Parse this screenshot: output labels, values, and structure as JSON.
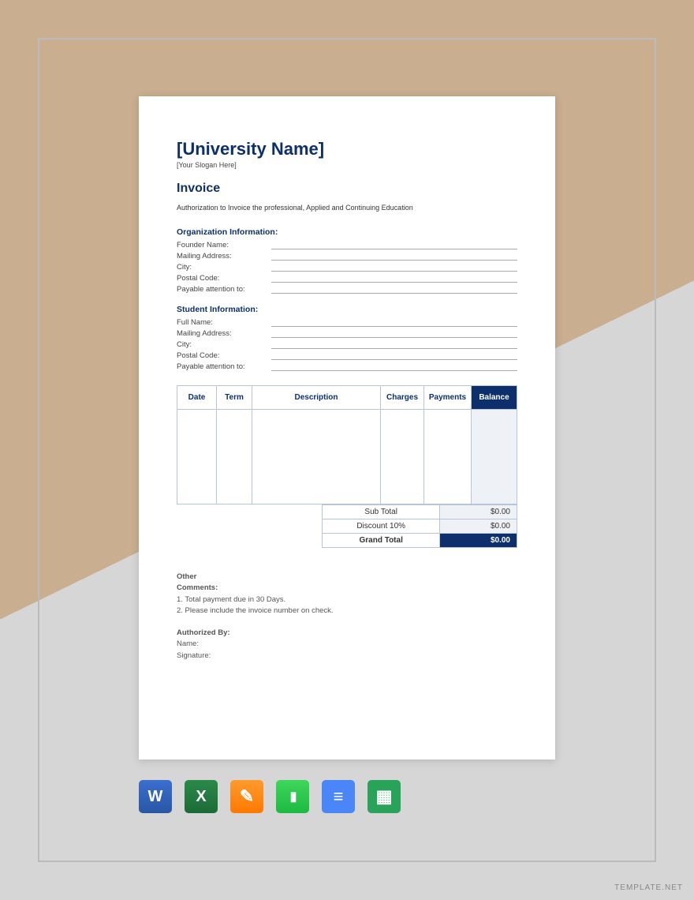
{
  "header": {
    "title": "[University Name]",
    "slogan": "[Your Slogan Here]",
    "invoice_label": "Invoice",
    "auth_text": "Authorization to Invoice the professional, Applied and  Continuing Education"
  },
  "organization": {
    "heading": "Organization Information:",
    "fields": {
      "founder": "Founder Name:",
      "mailing": "Mailing Address:",
      "city": "City:",
      "postal": "Postal Code:",
      "payable": "Payable attention to:"
    }
  },
  "student": {
    "heading": "Student Information:",
    "fields": {
      "fullname": "Full Name:",
      "mailing": "Mailing Address:",
      "city": "City:",
      "postal": "Postal Code:",
      "payable": "Payable attention to:"
    }
  },
  "table": {
    "headers": {
      "date": "Date",
      "term": "Term",
      "description": "Description",
      "charges": "Charges",
      "payments": "Payments",
      "balance": "Balance"
    }
  },
  "totals": {
    "subtotal_label": "Sub Total",
    "subtotal_value": "$0.00",
    "discount_label": "Discount 10%",
    "discount_value": "$0.00",
    "grand_label": "Grand Total",
    "grand_value": "$0.00"
  },
  "comments": {
    "other": "Other",
    "heading": "Comments:",
    "line1": "1. Total payment due in 30 Days.",
    "line2": "2. Please include the invoice number on check."
  },
  "authorized": {
    "heading": "Authorized By:",
    "name": "Name:",
    "signature": "Signature:"
  },
  "watermark": "TEMPLATE.NET"
}
